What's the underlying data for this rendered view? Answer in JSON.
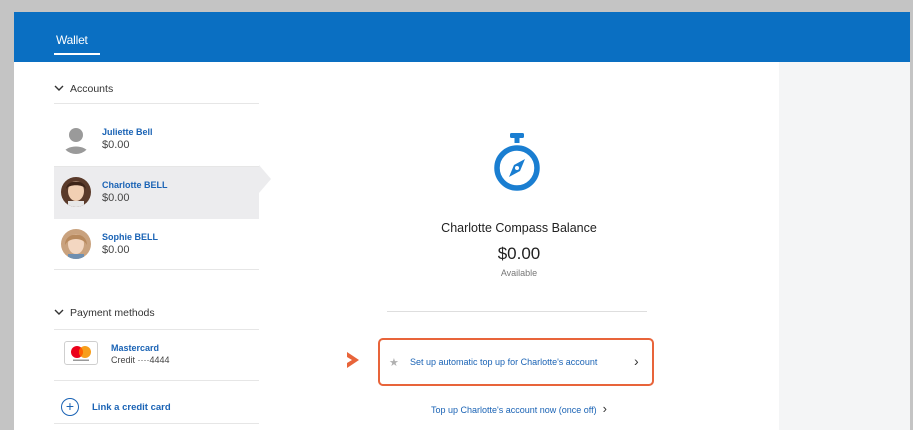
{
  "topbar": {
    "tab_label": "Wallet"
  },
  "sidebar": {
    "accounts_header": "Accounts",
    "accounts": [
      {
        "name": "Juliette Bell",
        "balance": "$0.00"
      },
      {
        "name": "Charlotte BELL",
        "balance": "$0.00"
      },
      {
        "name": "Sophie BELL",
        "balance": "$0.00"
      }
    ],
    "payment_header": "Payment methods",
    "payment_method": {
      "name": "Mastercard",
      "detail": "Credit ····4444"
    },
    "link_card_label": "Link a credit card"
  },
  "main": {
    "balance_title": "Charlotte Compass Balance",
    "balance_amount": "$0.00",
    "balance_status": "Available",
    "auto_topup_label": "Set up automatic top up for Charlotte's account",
    "topup_now_label": "Top up Charlotte's account now (once off)"
  },
  "colors": {
    "brand": "#0a6fc2",
    "link": "#1a63b5",
    "highlight": "#e8643a"
  }
}
